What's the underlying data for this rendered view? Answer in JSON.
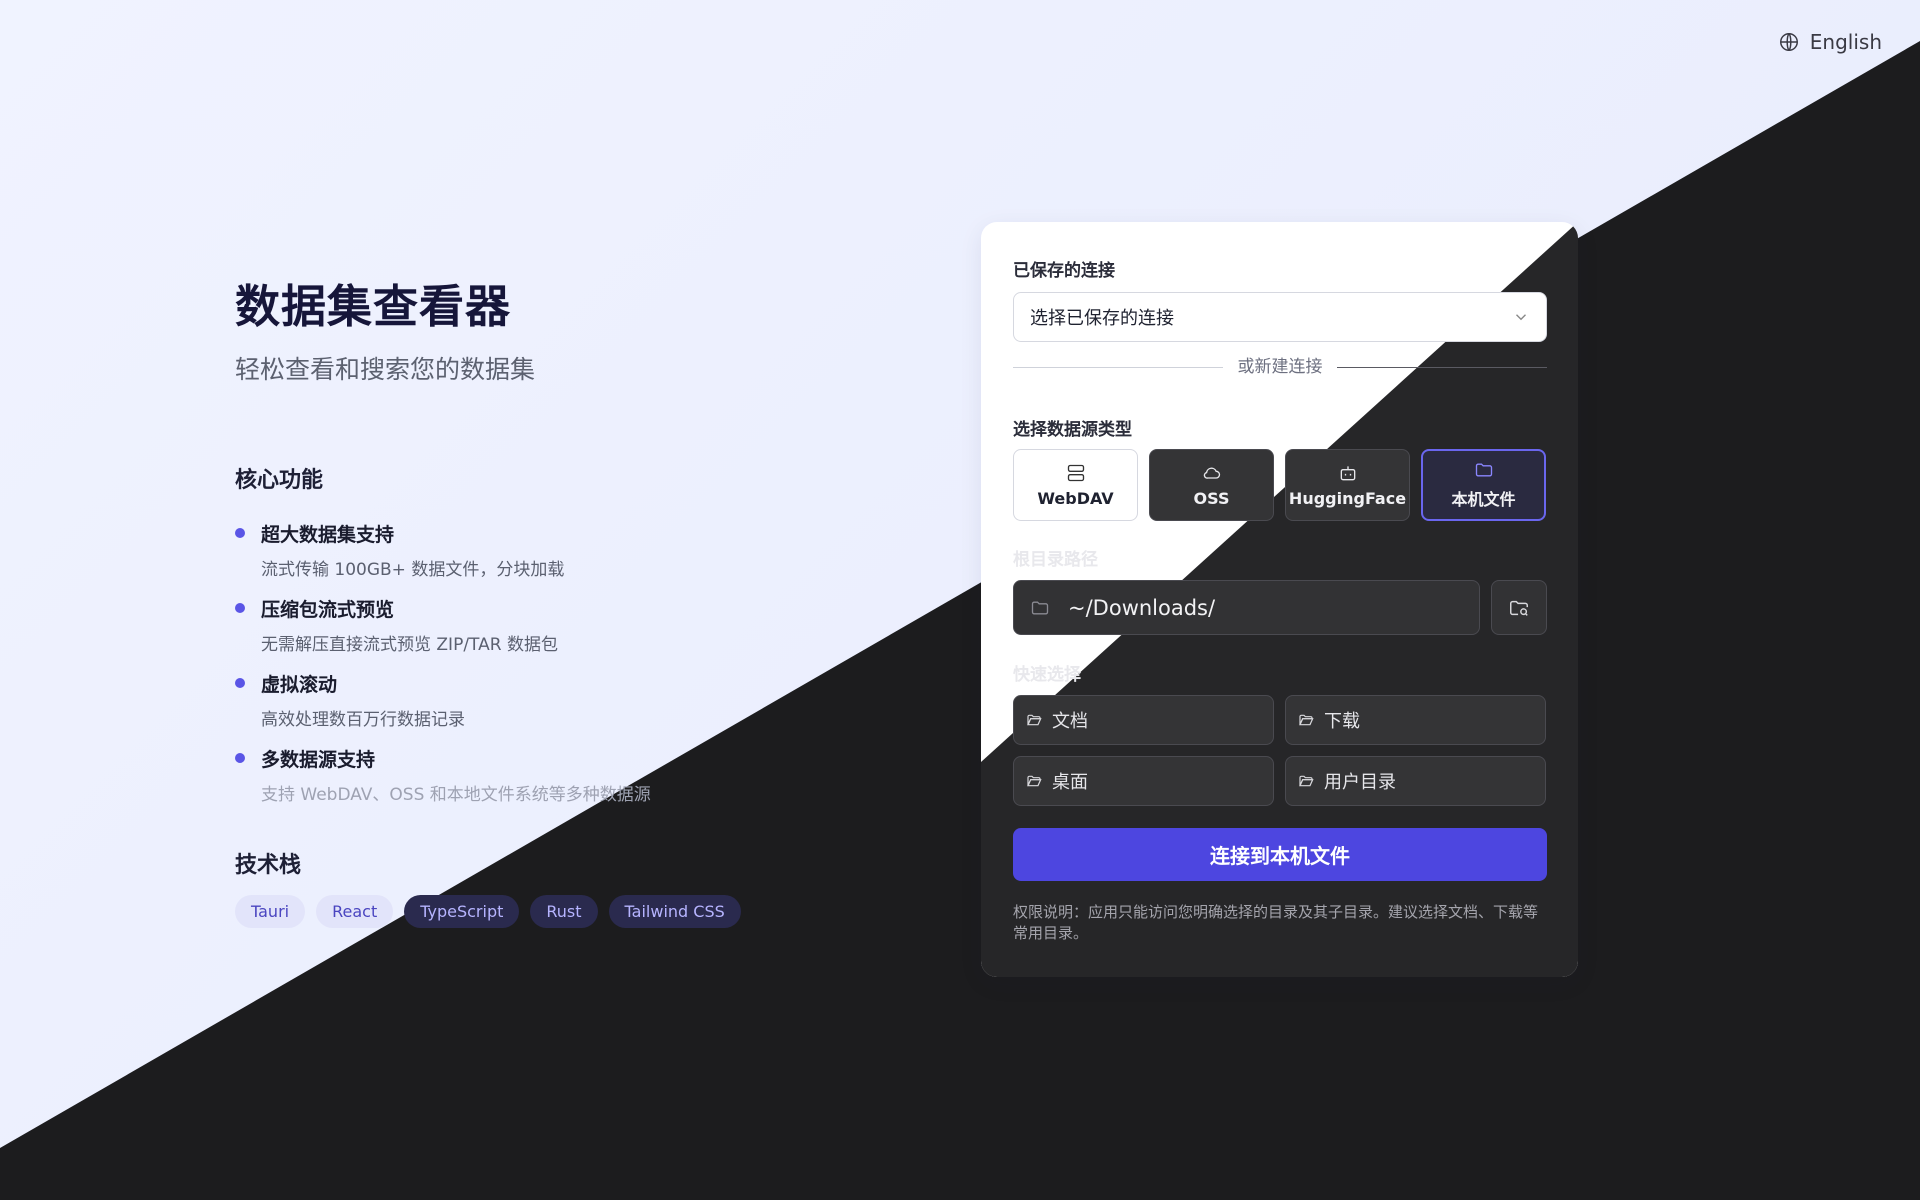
{
  "language": {
    "label": "English",
    "icon": "globe-icon"
  },
  "hero": {
    "title": "数据集查看器",
    "subtitle": "轻松查看和搜索您的数据集"
  },
  "features": {
    "heading": "核心功能",
    "items": [
      {
        "title": "超大数据集支持",
        "desc": "流式传输 100GB+ 数据文件，分块加载"
      },
      {
        "title": "压缩包流式预览",
        "desc": "无需解压直接流式预览 ZIP/TAR 数据包"
      },
      {
        "title": "虚拟滚动",
        "desc": "高效处理数百万行数据记录"
      },
      {
        "title": "多数据源支持",
        "desc": "支持 WebDAV、OSS 和本地文件系统等多种数据源"
      }
    ]
  },
  "tech_stack": {
    "heading": "技术栈",
    "tags": [
      "Tauri",
      "React",
      "TypeScript",
      "Rust",
      "Tailwind CSS"
    ]
  },
  "card": {
    "saved_label": "已保存的连接",
    "saved_select_value": "选择已保存的连接",
    "divider_text": "或新建连接",
    "source_type_label": "选择数据源类型",
    "source_types": [
      {
        "label": "WebDAV",
        "icon": "server-icon"
      },
      {
        "label": "OSS",
        "icon": "cloud-icon"
      },
      {
        "label": "HuggingFace",
        "icon": "bot-icon"
      },
      {
        "label": "本机文件",
        "icon": "folder-icon",
        "selected": true
      }
    ],
    "root_path_label": "根目录路径",
    "root_path_value": "~/Downloads/",
    "quick_label": "快速选择",
    "quick_items": [
      "文档",
      "下载",
      "桌面",
      "用户目录"
    ],
    "connect_label": "连接到本机文件",
    "permission_note": "权限说明：应用只能访问您明确选择的目录及其子目录。建议选择文档、下载等常用目录。"
  },
  "colors": {
    "accent": "#4d46e0",
    "dark_bg": "#1c1c1e",
    "light_bg": "#eef1fd"
  }
}
